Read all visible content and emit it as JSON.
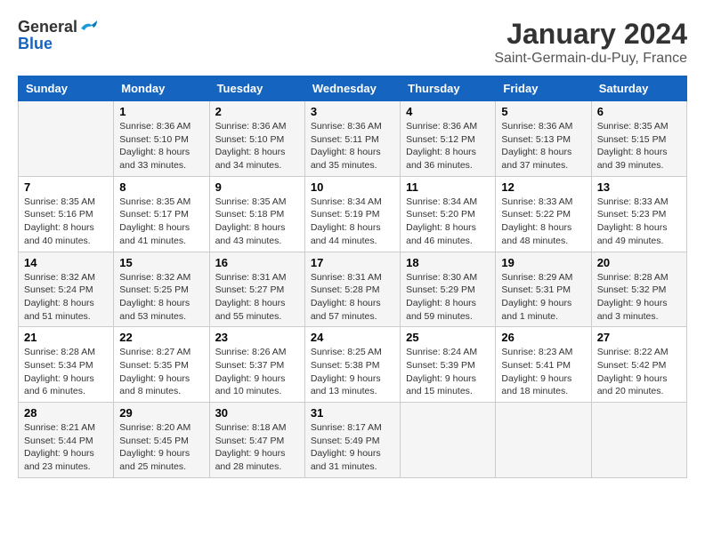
{
  "header": {
    "logo_general": "General",
    "logo_blue": "Blue",
    "title": "January 2024",
    "subtitle": "Saint-Germain-du-Puy, France"
  },
  "weekdays": [
    "Sunday",
    "Monday",
    "Tuesday",
    "Wednesday",
    "Thursday",
    "Friday",
    "Saturday"
  ],
  "weeks": [
    [
      {
        "day": "",
        "sunrise": "",
        "sunset": "",
        "daylight": ""
      },
      {
        "day": "1",
        "sunrise": "Sunrise: 8:36 AM",
        "sunset": "Sunset: 5:10 PM",
        "daylight": "Daylight: 8 hours and 33 minutes."
      },
      {
        "day": "2",
        "sunrise": "Sunrise: 8:36 AM",
        "sunset": "Sunset: 5:10 PM",
        "daylight": "Daylight: 8 hours and 34 minutes."
      },
      {
        "day": "3",
        "sunrise": "Sunrise: 8:36 AM",
        "sunset": "Sunset: 5:11 PM",
        "daylight": "Daylight: 8 hours and 35 minutes."
      },
      {
        "day": "4",
        "sunrise": "Sunrise: 8:36 AM",
        "sunset": "Sunset: 5:12 PM",
        "daylight": "Daylight: 8 hours and 36 minutes."
      },
      {
        "day": "5",
        "sunrise": "Sunrise: 8:36 AM",
        "sunset": "Sunset: 5:13 PM",
        "daylight": "Daylight: 8 hours and 37 minutes."
      },
      {
        "day": "6",
        "sunrise": "Sunrise: 8:35 AM",
        "sunset": "Sunset: 5:15 PM",
        "daylight": "Daylight: 8 hours and 39 minutes."
      }
    ],
    [
      {
        "day": "7",
        "sunrise": "Sunrise: 8:35 AM",
        "sunset": "Sunset: 5:16 PM",
        "daylight": "Daylight: 8 hours and 40 minutes."
      },
      {
        "day": "8",
        "sunrise": "Sunrise: 8:35 AM",
        "sunset": "Sunset: 5:17 PM",
        "daylight": "Daylight: 8 hours and 41 minutes."
      },
      {
        "day": "9",
        "sunrise": "Sunrise: 8:35 AM",
        "sunset": "Sunset: 5:18 PM",
        "daylight": "Daylight: 8 hours and 43 minutes."
      },
      {
        "day": "10",
        "sunrise": "Sunrise: 8:34 AM",
        "sunset": "Sunset: 5:19 PM",
        "daylight": "Daylight: 8 hours and 44 minutes."
      },
      {
        "day": "11",
        "sunrise": "Sunrise: 8:34 AM",
        "sunset": "Sunset: 5:20 PM",
        "daylight": "Daylight: 8 hours and 46 minutes."
      },
      {
        "day": "12",
        "sunrise": "Sunrise: 8:33 AM",
        "sunset": "Sunset: 5:22 PM",
        "daylight": "Daylight: 8 hours and 48 minutes."
      },
      {
        "day": "13",
        "sunrise": "Sunrise: 8:33 AM",
        "sunset": "Sunset: 5:23 PM",
        "daylight": "Daylight: 8 hours and 49 minutes."
      }
    ],
    [
      {
        "day": "14",
        "sunrise": "Sunrise: 8:32 AM",
        "sunset": "Sunset: 5:24 PM",
        "daylight": "Daylight: 8 hours and 51 minutes."
      },
      {
        "day": "15",
        "sunrise": "Sunrise: 8:32 AM",
        "sunset": "Sunset: 5:25 PM",
        "daylight": "Daylight: 8 hours and 53 minutes."
      },
      {
        "day": "16",
        "sunrise": "Sunrise: 8:31 AM",
        "sunset": "Sunset: 5:27 PM",
        "daylight": "Daylight: 8 hours and 55 minutes."
      },
      {
        "day": "17",
        "sunrise": "Sunrise: 8:31 AM",
        "sunset": "Sunset: 5:28 PM",
        "daylight": "Daylight: 8 hours and 57 minutes."
      },
      {
        "day": "18",
        "sunrise": "Sunrise: 8:30 AM",
        "sunset": "Sunset: 5:29 PM",
        "daylight": "Daylight: 8 hours and 59 minutes."
      },
      {
        "day": "19",
        "sunrise": "Sunrise: 8:29 AM",
        "sunset": "Sunset: 5:31 PM",
        "daylight": "Daylight: 9 hours and 1 minute."
      },
      {
        "day": "20",
        "sunrise": "Sunrise: 8:28 AM",
        "sunset": "Sunset: 5:32 PM",
        "daylight": "Daylight: 9 hours and 3 minutes."
      }
    ],
    [
      {
        "day": "21",
        "sunrise": "Sunrise: 8:28 AM",
        "sunset": "Sunset: 5:34 PM",
        "daylight": "Daylight: 9 hours and 6 minutes."
      },
      {
        "day": "22",
        "sunrise": "Sunrise: 8:27 AM",
        "sunset": "Sunset: 5:35 PM",
        "daylight": "Daylight: 9 hours and 8 minutes."
      },
      {
        "day": "23",
        "sunrise": "Sunrise: 8:26 AM",
        "sunset": "Sunset: 5:37 PM",
        "daylight": "Daylight: 9 hours and 10 minutes."
      },
      {
        "day": "24",
        "sunrise": "Sunrise: 8:25 AM",
        "sunset": "Sunset: 5:38 PM",
        "daylight": "Daylight: 9 hours and 13 minutes."
      },
      {
        "day": "25",
        "sunrise": "Sunrise: 8:24 AM",
        "sunset": "Sunset: 5:39 PM",
        "daylight": "Daylight: 9 hours and 15 minutes."
      },
      {
        "day": "26",
        "sunrise": "Sunrise: 8:23 AM",
        "sunset": "Sunset: 5:41 PM",
        "daylight": "Daylight: 9 hours and 18 minutes."
      },
      {
        "day": "27",
        "sunrise": "Sunrise: 8:22 AM",
        "sunset": "Sunset: 5:42 PM",
        "daylight": "Daylight: 9 hours and 20 minutes."
      }
    ],
    [
      {
        "day": "28",
        "sunrise": "Sunrise: 8:21 AM",
        "sunset": "Sunset: 5:44 PM",
        "daylight": "Daylight: 9 hours and 23 minutes."
      },
      {
        "day": "29",
        "sunrise": "Sunrise: 8:20 AM",
        "sunset": "Sunset: 5:45 PM",
        "daylight": "Daylight: 9 hours and 25 minutes."
      },
      {
        "day": "30",
        "sunrise": "Sunrise: 8:18 AM",
        "sunset": "Sunset: 5:47 PM",
        "daylight": "Daylight: 9 hours and 28 minutes."
      },
      {
        "day": "31",
        "sunrise": "Sunrise: 8:17 AM",
        "sunset": "Sunset: 5:49 PM",
        "daylight": "Daylight: 9 hours and 31 minutes."
      },
      {
        "day": "",
        "sunrise": "",
        "sunset": "",
        "daylight": ""
      },
      {
        "day": "",
        "sunrise": "",
        "sunset": "",
        "daylight": ""
      },
      {
        "day": "",
        "sunrise": "",
        "sunset": "",
        "daylight": ""
      }
    ]
  ]
}
